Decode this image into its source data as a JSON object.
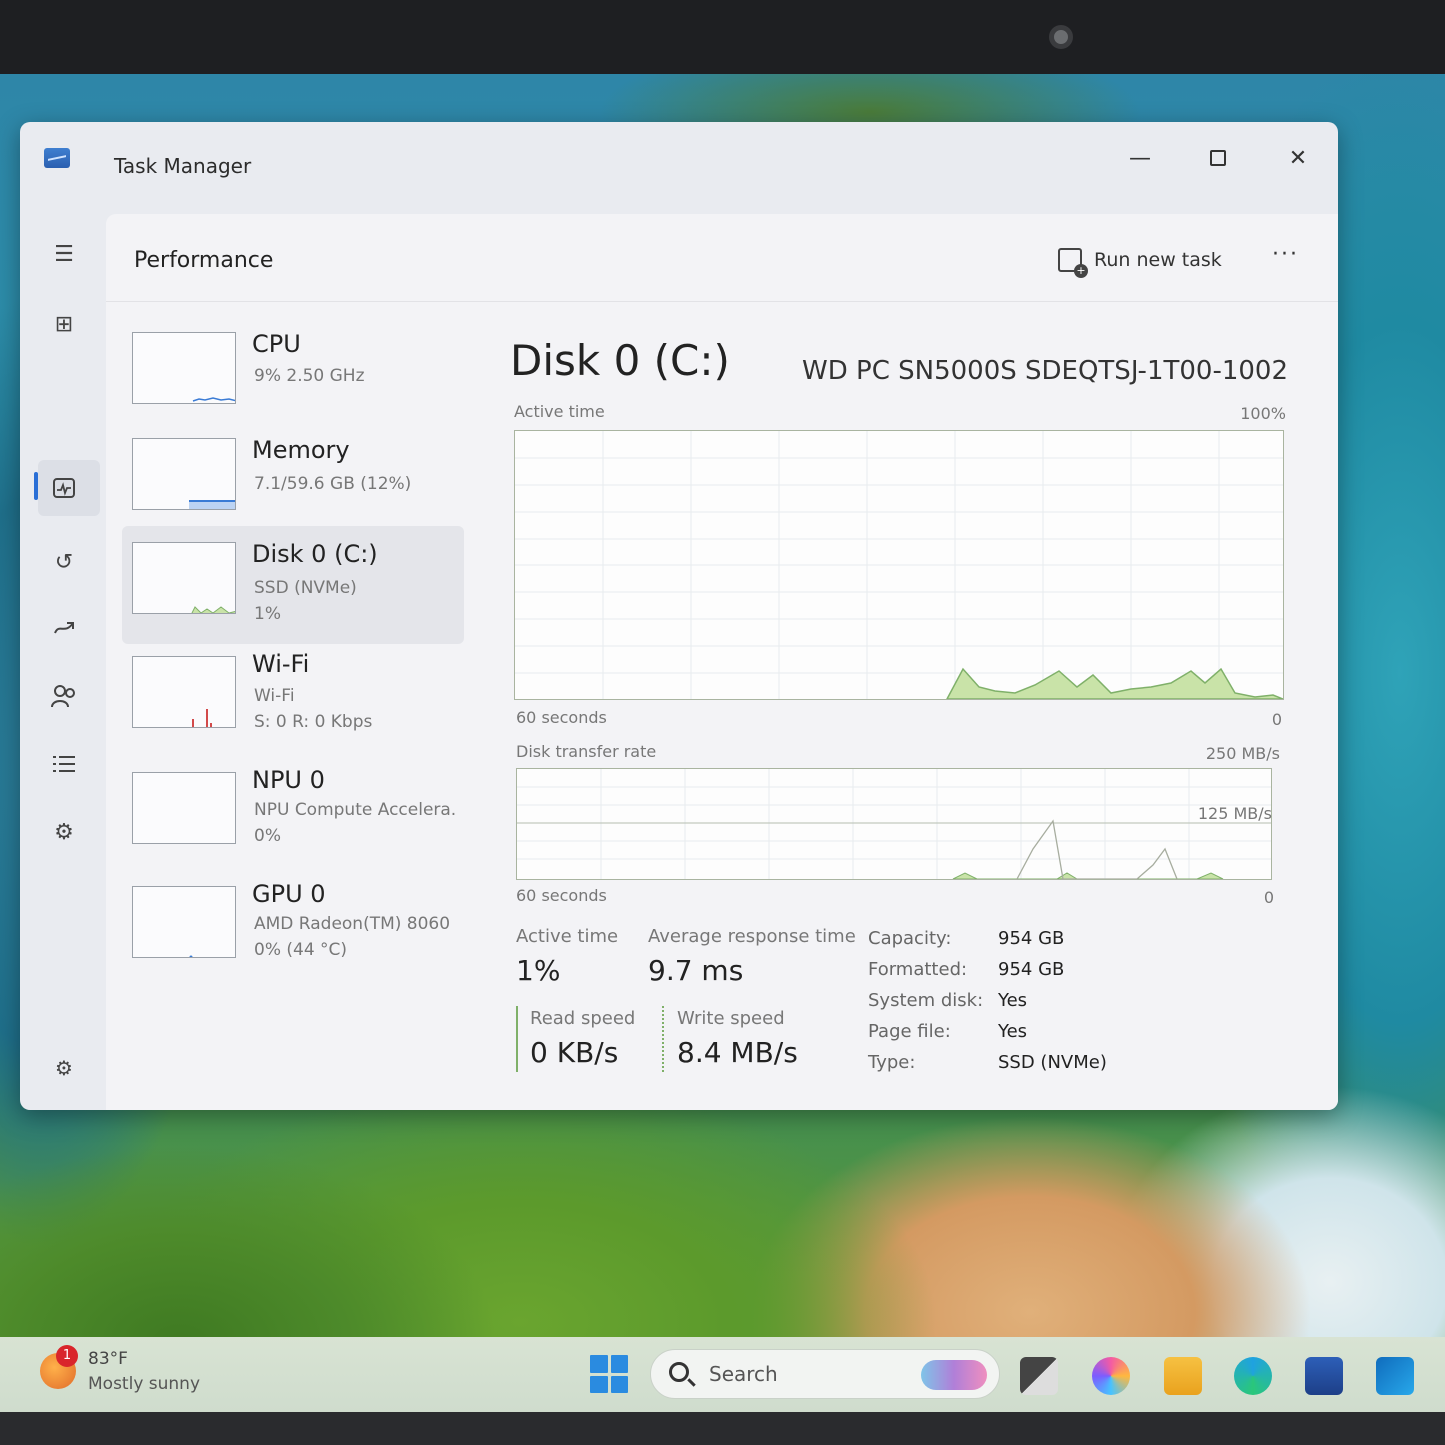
{
  "window": {
    "title": "Task Manager"
  },
  "header": {
    "title": "Performance",
    "run_new_task": "Run new task",
    "more": "···"
  },
  "nav": [
    "menu-icon",
    "processes-icon",
    "performance-icon",
    "app-history-icon",
    "startup-apps-icon",
    "users-icon",
    "details-icon",
    "services-icon",
    "settings-icon"
  ],
  "devices": [
    {
      "name": "CPU",
      "line1": "9%  2.50 GHz",
      "line2": ""
    },
    {
      "name": "Memory",
      "line1": "7.1/59.6 GB (12%)",
      "line2": ""
    },
    {
      "name": "Disk 0 (C:)",
      "line1": "SSD (NVMe)",
      "line2": "1%"
    },
    {
      "name": "Wi-Fi",
      "line1": "Wi-Fi",
      "line2": "S: 0  R: 0 Kbps"
    },
    {
      "name": "NPU 0",
      "line1": "NPU Compute Accelera.",
      "line2": "0%"
    },
    {
      "name": "GPU 0",
      "line1": "AMD Radeon(TM) 8060",
      "line2": "0%  (44 °C)"
    }
  ],
  "detail": {
    "title": "Disk 0 (C:)",
    "model": "WD PC SN5000S SDEQTSJ-1T00-1002",
    "active_graph": {
      "label": "Active time",
      "max": "100%",
      "time": "60 seconds",
      "min": "0"
    },
    "transfer_graph": {
      "label": "Disk transfer rate",
      "max": "250 MB/s",
      "mid": "125 MB/s",
      "time": "60 seconds",
      "min": "0"
    },
    "stats": {
      "active_time_label": "Active time",
      "active_time": "1%",
      "resp_label": "Average response time",
      "resp": "9.7 ms",
      "read_label": "Read speed",
      "read": "0 KB/s",
      "write_label": "Write speed",
      "write": "8.4 MB/s"
    },
    "props": [
      {
        "k": "Capacity:",
        "v": "954 GB"
      },
      {
        "k": "Formatted:",
        "v": "954 GB"
      },
      {
        "k": "System disk:",
        "v": "Yes"
      },
      {
        "k": "Page file:",
        "v": "Yes"
      },
      {
        "k": "Type:",
        "v": "SSD (NVMe)"
      }
    ]
  },
  "taskbar": {
    "weather_badge": "1",
    "temp": "83°F",
    "condition": "Mostly sunny",
    "search_placeholder": "Search"
  },
  "colors": {
    "accent": "#2a6fd6",
    "disk_graph": "#7fb069",
    "disk_fill": "#c9e3a8",
    "wifi_graph": "#d24a4a",
    "mem_graph": "#3a7bd5"
  }
}
